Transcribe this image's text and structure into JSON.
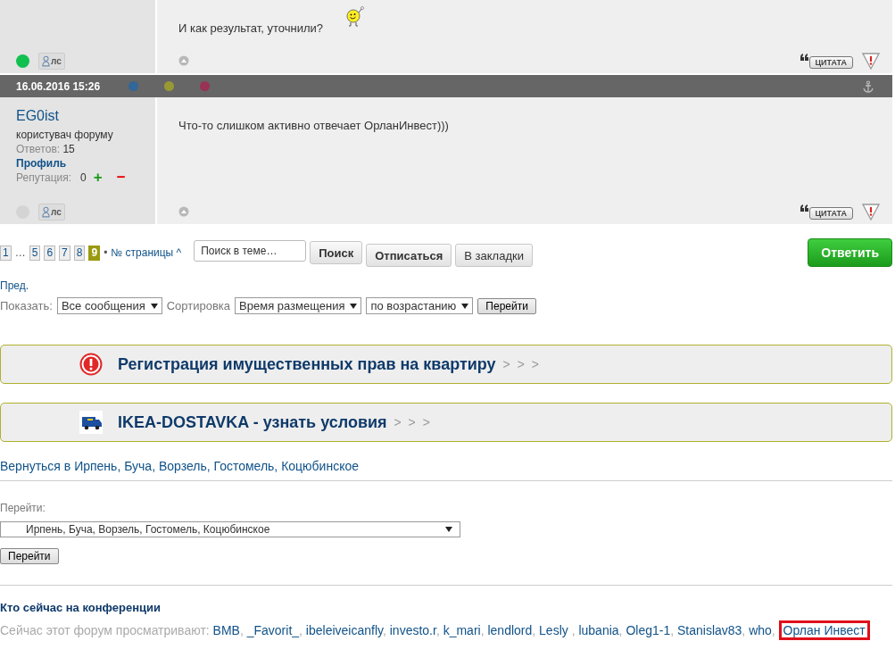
{
  "posts": [
    {
      "body": "И как результат, уточнили?",
      "smiley": true,
      "online": true,
      "pm_label": "лс",
      "quote_label": "ЦИТАТА"
    },
    {
      "header": {
        "date": "16.06.2016 15:26",
        "dots": [
          {
            "color": "#336699"
          },
          {
            "color": "#999933"
          },
          {
            "color": "#993355"
          }
        ]
      },
      "author": {
        "name": "EG0ist",
        "rank": "користувач форуму",
        "posts_label": "Ответов:",
        "posts": "15",
        "profile": "Профиль",
        "rep_label": "Репутация:",
        "rep": "0",
        "plus": "+",
        "minus": "−"
      },
      "body": "Что-то слишком активно отвечает ОрланИнвест)))",
      "online": false,
      "pm_label": "лс",
      "quote_label": "ЦИТАТА"
    }
  ],
  "pagination": {
    "items": [
      {
        "kind": "page",
        "label": "1",
        "selected": false
      },
      {
        "kind": "gap",
        "label": "…"
      },
      {
        "kind": "page",
        "label": "5",
        "selected": false
      },
      {
        "kind": "page",
        "label": "6",
        "selected": false
      },
      {
        "kind": "page",
        "label": "7",
        "selected": false
      },
      {
        "kind": "page",
        "label": "8",
        "selected": false
      },
      {
        "kind": "page",
        "label": "9",
        "selected": true
      }
    ],
    "bullet": "•",
    "jump": "№ страницы ^"
  },
  "search": {
    "placeholder": "Поиск в теме…",
    "button": "Поиск"
  },
  "actions": [
    "Отписаться",
    "В закладки"
  ],
  "reply": "Ответить",
  "prev": "Пред.",
  "filters": {
    "show_label": "Показать:",
    "show": "Все сообщения",
    "sort_label": "Сортировка",
    "sort": "Время размещения",
    "order": "по возрастанию",
    "go": "Перейти"
  },
  "banners": [
    {
      "kind": "alert",
      "text": "Регистрация имущественных прав на квартиру",
      "arrows": "> > >"
    },
    {
      "kind": "truck",
      "text": "IKEA-DOSTAVKA - узнать условия",
      "arrows": "> > >"
    }
  ],
  "back_link": "Вернуться в Ирпень, Буча, Ворзель, Гостомель, Коцюбинское",
  "jump": {
    "label": "Перейти:",
    "value": "Ирпень, Буча, Ворзель, Гостомель, Коцюбинское",
    "button": "Перейти"
  },
  "online": {
    "title": "Кто сейчас на конференции",
    "lead": "Сейчас этот форум просматривают:",
    "users": [
      {
        "name": "BMB",
        "after": ", ",
        "highlighted": false
      },
      {
        "name": "_Favorit_",
        "after": ", ",
        "highlighted": false
      },
      {
        "name": "ibeleiveicanfly",
        "after": ", ",
        "highlighted": false
      },
      {
        "name": "investo.r",
        "after": ", ",
        "highlighted": false
      },
      {
        "name": "k_mari",
        "after": ", ",
        "highlighted": false
      },
      {
        "name": "lendlord",
        "after": ", ",
        "highlighted": false
      },
      {
        "name": "Lesly",
        "after": " , ",
        "highlighted": false
      },
      {
        "name": "lubania",
        "after": ", ",
        "highlighted": false
      },
      {
        "name": "Oleg1-1",
        "after": ", ",
        "highlighted": false
      },
      {
        "name": "Stanislav83",
        "after": ", ",
        "highlighted": false
      },
      {
        "name": "who",
        "after": ", ",
        "highlighted": false
      },
      {
        "name": "Орлан Инвест",
        "highlighted": true
      }
    ]
  }
}
